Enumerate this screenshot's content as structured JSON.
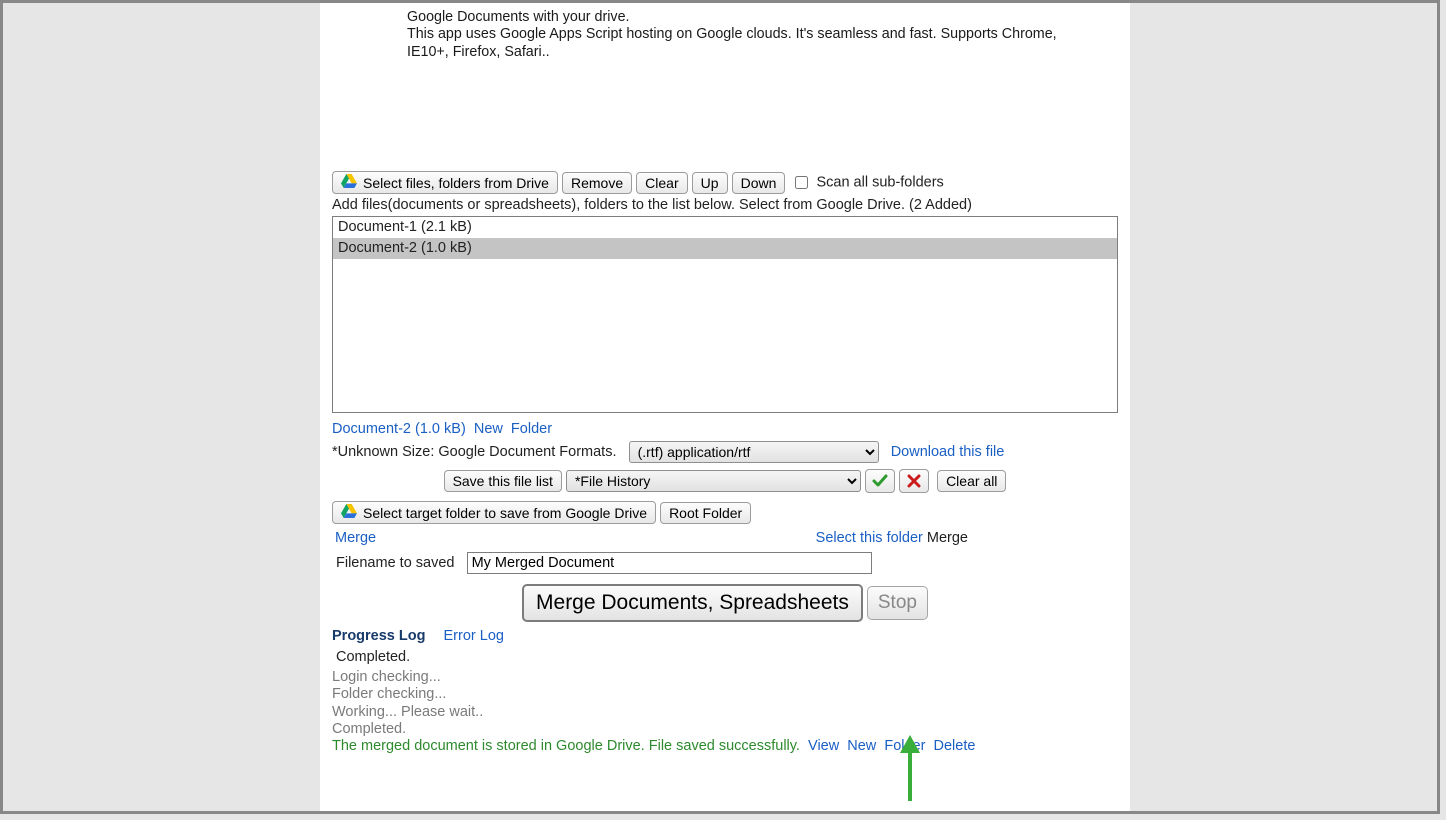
{
  "desc": {
    "line1": "Google Documents with your drive.",
    "line2": "This app uses Google Apps Script hosting on Google clouds. It's seamless and fast. Supports Chrome, IE10+, Firefox, Safari.."
  },
  "toolbar": {
    "select_files": "Select files, folders from Drive",
    "remove": "Remove",
    "clear": "Clear",
    "up": "Up",
    "down": "Down",
    "scan_label": "Scan all sub-folders"
  },
  "hint": "Add files(documents or spreadsheets), folders to the list below. Select from Google Drive. (2 Added)",
  "files": {
    "item0": "Document-1 (2.1 kB)",
    "item1": "Document-2 (1.0 kB)"
  },
  "linkline": {
    "doc": "Document-2 (1.0 kB)",
    "new": "New",
    "folder": "Folder"
  },
  "unk": {
    "label": "*Unknown Size: Google Document Formats.",
    "format_selected": "(.rtf) application/rtf",
    "download": "Download this file"
  },
  "history": {
    "save_list": "Save this file list",
    "history_selected": "*File History",
    "clear_all": "Clear all"
  },
  "target": {
    "select_target": "Select target folder to save from Google Drive",
    "root_folder": "Root Folder"
  },
  "mergeline": {
    "merge": "Merge",
    "select_this_folder": "Select this folder",
    "merge_right": "Merge"
  },
  "filename": {
    "label": "Filename to saved",
    "value": "My Merged Document"
  },
  "big": {
    "merge_btn": "Merge Documents, Spreadsheets",
    "stop_btn": "Stop"
  },
  "tabs": {
    "progress": "Progress Log",
    "error": "Error Log"
  },
  "status": {
    "completed_top": "Completed.",
    "l1": "Login checking...",
    "l2": "Folder checking...",
    "l3": "Working... Please wait..",
    "l4": "Completed.",
    "success": "The merged document is stored in Google Drive. File saved successfully.",
    "view": "View",
    "new": "New",
    "folder": "Folder",
    "delete": "Delete"
  }
}
